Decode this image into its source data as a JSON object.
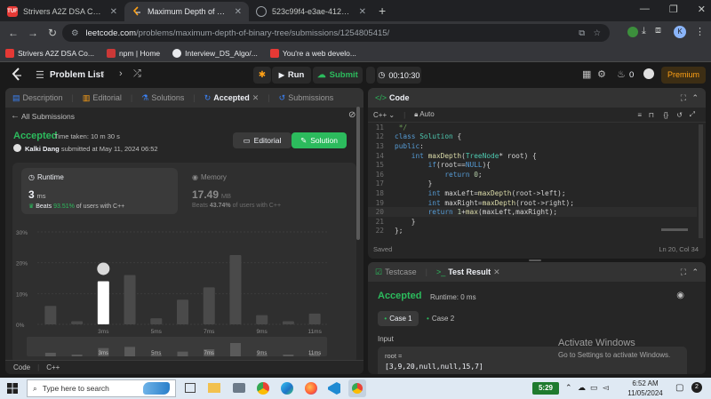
{
  "browser": {
    "tabs": [
      {
        "fav": "TUF",
        "fav_color": "#e53935",
        "title": "Strivers A2Z DSA Course/Sheet"
      },
      {
        "fav": "",
        "fav_color": "#ffa116",
        "title": "Maximum Depth of Binary Tree"
      },
      {
        "fav": "",
        "fav_color": "#5f6368",
        "title": "523c99f4-e3ae-4123-8454-ae..."
      }
    ],
    "url_host": "leetcode.com",
    "url_path": "/problems/maximum-depth-of-binary-tree/submissions/1254805415/",
    "profile_letter": "K",
    "bookmarks": [
      {
        "label": "Strivers A2Z DSA Co...",
        "color": "#e53935"
      },
      {
        "label": "npm | Home",
        "color": "#cb3837"
      },
      {
        "label": "Interview_DS_Algo/...",
        "color": "#e8eaed"
      },
      {
        "label": "You're a web develo...",
        "color": "#e53935"
      }
    ]
  },
  "lcnav": {
    "problem_list": "Problem List",
    "run": "Run",
    "submit": "Submit",
    "timer": "00:10:30",
    "fire_count": "0",
    "premium": "Premium"
  },
  "left": {
    "tabs": [
      "Description",
      "Editorial",
      "Solutions",
      "Accepted",
      "Submissions"
    ],
    "all_submissions": "All Submissions",
    "status": "Accepted",
    "time_taken": "Time taken: 10 m 30 s",
    "user": "Kalki Dang",
    "submitted_at": "submitted at May 11, 2024 06:52",
    "editorial_btn": "Editorial",
    "solution_btn": "Solution",
    "runtime_label": "Runtime",
    "runtime_value": "3",
    "runtime_unit": "ms",
    "runtime_beats_prefix": "Beats",
    "runtime_beats_pct": "93.51%",
    "runtime_beats_suffix": "of users with C++",
    "memory_label": "Memory",
    "memory_value": "17.49",
    "memory_unit": "MB",
    "memory_beats_prefix": "Beats",
    "memory_beats_pct": "43.74%",
    "memory_beats_suffix": "of users with C++",
    "footer_code": "Code",
    "footer_lang": "C++"
  },
  "chart_data": {
    "type": "bar",
    "ylabel_ticks": [
      "30%",
      "20%",
      "10%",
      "0%"
    ],
    "ylim": [
      0,
      30
    ],
    "x_tick_labels": [
      "3ms",
      "5ms",
      "7ms",
      "9ms",
      "11ms"
    ],
    "categories": [
      "1ms",
      "2ms",
      "3ms",
      "4ms",
      "5ms",
      "6ms",
      "7ms",
      "8ms",
      "9ms",
      "10ms",
      "11ms"
    ],
    "values": [
      6,
      1,
      14,
      16,
      2,
      8,
      12,
      22.5,
      3,
      1,
      3.5
    ],
    "highlight_index": 2,
    "bar_color": "#4a4a4a",
    "highlight_color": "#ffffff"
  },
  "code": {
    "title": "Code",
    "lang": "C++",
    "auto": "Auto",
    "saved": "Saved",
    "position": "Ln 20, Col 34",
    "lines": [
      {
        "n": "11",
        "html": "<span class='cm'> */</span>"
      },
      {
        "n": "12",
        "html": "<span class='kw'>class</span> <span class='ty'>Solution</span> <span class='tx'>{</span>"
      },
      {
        "n": "13",
        "html": "<span class='kw'>public</span><span class='tx'>:</span>"
      },
      {
        "n": "14",
        "html": "    <span class='kw'>int</span> <span class='fn'>maxDepth</span><span class='tx'>(</span><span class='ty'>TreeNode</span><span class='tx'>* root) {</span>"
      },
      {
        "n": "15",
        "html": "        <span class='kw'>if</span><span class='tx'>(root==</span><span class='kw'>NULL</span><span class='tx'>){</span>"
      },
      {
        "n": "16",
        "html": "            <span class='kw'>return</span> <span class='nu'>0</span><span class='tx'>;</span>"
      },
      {
        "n": "17",
        "html": "        <span class='tx'>}</span>"
      },
      {
        "n": "18",
        "html": "        <span class='kw'>int</span> <span class='tx'>maxLeft=</span><span class='fn'>maxDepth</span><span class='tx'>(root-&gt;left);</span>"
      },
      {
        "n": "19",
        "html": "        <span class='kw'>int</span> <span class='tx'>maxRight=</span><span class='fn'>maxDepth</span><span class='tx'>(root-&gt;right);</span>"
      },
      {
        "n": "20",
        "html": "        <span class='kw'>return</span> <span class='nu'>1</span><span class='tx'>+</span><span class='fn'>max</span><span class='tx'>(maxLeft,maxRight);</span>"
      },
      {
        "n": "21",
        "html": "    <span class='tx'>}</span>"
      },
      {
        "n": "22",
        "html": "<span class='tx'>};</span>"
      }
    ]
  },
  "testpanel": {
    "testcase_tab": "Testcase",
    "result_tab": "Test Result",
    "status": "Accepted",
    "runtime": "Runtime: 0 ms",
    "case1": "Case 1",
    "case2": "Case 2",
    "input_label": "Input",
    "param": "root =",
    "value": "[3,9,20,null,null,15,7]"
  },
  "watermark": {
    "line1": "Activate Windows",
    "line2": "Go to Settings to activate Windows."
  },
  "taskbar": {
    "search_placeholder": "Type here to search",
    "badge": "5:29",
    "time": "6:52 AM",
    "date": "11/05/2024"
  }
}
